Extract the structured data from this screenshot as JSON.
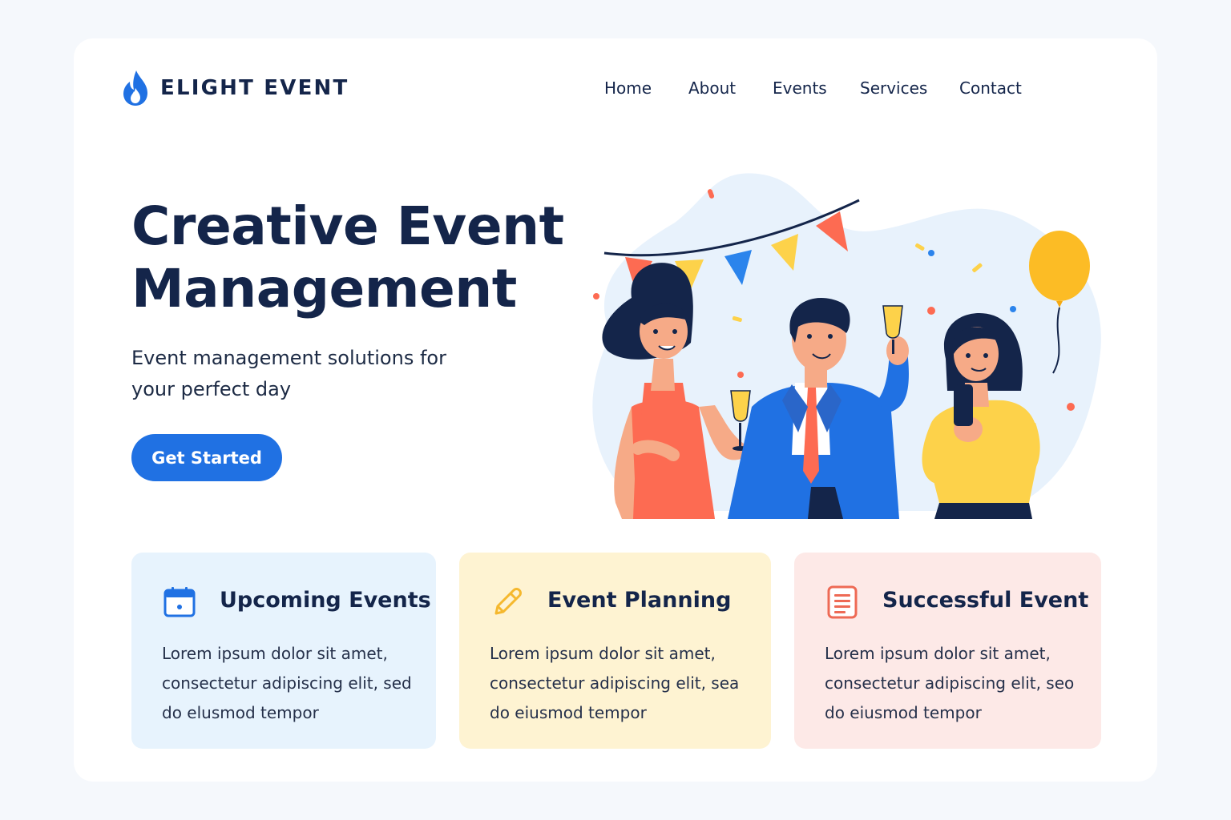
{
  "brand": {
    "name": "ELIGHT EVENT",
    "icon": "flame-drop-icon",
    "color": "#2071e3"
  },
  "nav": {
    "items": [
      "Home",
      "About",
      "Events",
      "Services",
      "Contact"
    ]
  },
  "hero": {
    "title": "Creative Event Management",
    "subtitle": "Event management solutions for your perfect day",
    "cta_label": "Get Started"
  },
  "features": [
    {
      "icon": "calendar-icon",
      "title": "Upcoming Events",
      "body": "Lorem ipsum dolor sit amet, consectetur adipiscing elit, sed do elusmod tempor",
      "bg": "#e7f3fd",
      "accent": "#2071e3"
    },
    {
      "icon": "pencil-icon",
      "title": "Event Planning",
      "body": "Lorem ipsum dolor sit amet, consectetur adipiscing elit, sea do eiusmod tempor",
      "bg": "#fef3d2",
      "accent": "#f5b82e"
    },
    {
      "icon": "document-icon",
      "title": "Successful Event",
      "body": "Lorem ipsum dolor sit amet, consectetur adipiscing elit, seo do eiusmod tempor",
      "bg": "#fde9e7",
      "accent": "#ee6a55"
    }
  ],
  "colors": {
    "primary": "#2071e3",
    "text": "#14254a",
    "coral": "#fd6b52",
    "yellow": "#fdd24a"
  }
}
